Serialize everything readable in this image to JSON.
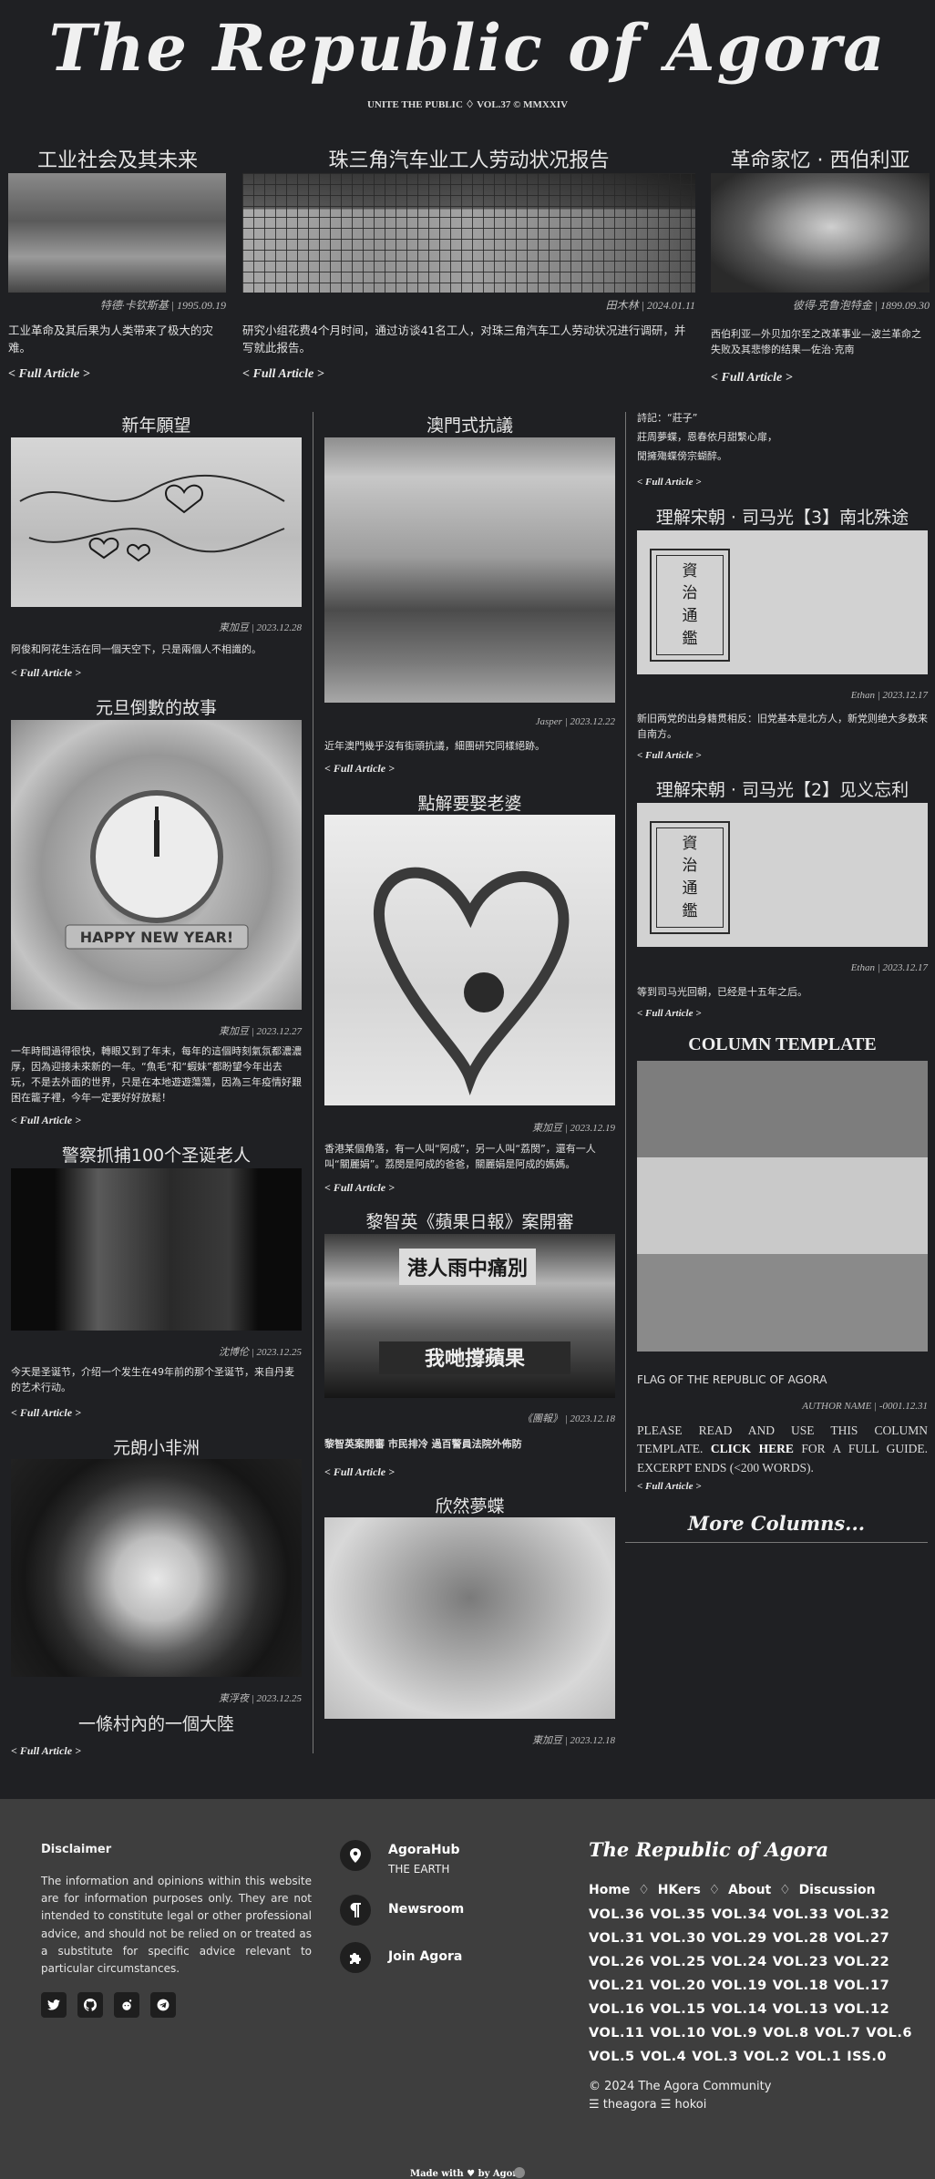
{
  "masthead": {
    "title": "The Republic of Agora",
    "subtitle": "UNITE THE PUBLIC ♢ VOL.37 © MMXXIV"
  },
  "top_row": [
    {
      "title": "工业社会及其未来",
      "credit": "特德·卡钦斯基 | 1995.09.19",
      "desc": "工业革命及其后果为人类带来了极大的灾难。",
      "more": "< Full Article >"
    },
    {
      "title": "珠三角汽车业工人劳动状况报告",
      "credit": "田木林 | 2024.01.11",
      "desc": "研究小组花费4个月时间，通过访谈41名工人，对珠三角汽车工人劳动状况进行调研，并写就此报告。",
      "more": "< Full Article >"
    },
    {
      "title": "革命家忆 · 西伯利亚",
      "credit": "彼得·克鲁泡特金 | 1899.09.30",
      "desc_line1": "西伯利亚—外贝加尔至之改革事业—波兰革命之",
      "desc_line2": "失败及其悲惨的结果—佐治·克南",
      "more": "< Full Article >"
    }
  ],
  "col1": [
    {
      "title": "新年願望",
      "credit": "東加豆 | 2023.12.28",
      "desc": "阿俊和阿花生活在同一個天空下，只是兩個人不相識的。",
      "more": "< Full Article >"
    },
    {
      "title": "元旦倒數的故事",
      "credit": "東加豆 | 2023.12.27",
      "desc": "一年時間過得很快，轉眼又到了年末，每年的這個時刻氣氛都濃濃厚，因為迎接未來新的一年。“魚毛”和“蝦妹”都盼望今年出去玩，不是去外面的世界，只是在本地遊遊蕩蕩，因為三年疫情好艱困在籠子裡，今年一定要好好放鬆！",
      "more": "< Full Article >",
      "clock_banner": "HAPPY NEW YEAR!"
    },
    {
      "title": "警察抓捕100个圣诞老人",
      "credit": "沈博伦 | 2023.12.25",
      "desc": "今天是圣诞节，介绍一个发生在49年前的那个圣诞节，来自丹麦的艺术行动。",
      "more": "< Full Article >"
    },
    {
      "title": "元朗小非洲",
      "credit": "東浮夜 | 2023.12.25",
      "subtitle": "一條村內的一個大陸",
      "more": "< Full Article >"
    }
  ],
  "col2": [
    {
      "title": "澳門式抗議",
      "credit": "Jasper | 2023.12.22",
      "desc": "近年澳門幾乎沒有街頭抗議，細團研究同樣絕跡。",
      "more": "< Full Article >"
    },
    {
      "title": "點解要娶老婆",
      "credit": "東加豆 | 2023.12.19",
      "desc": "香港某個角落，有一人叫“阿成”，另一人叫“荔閔”，還有一人叫“關麗娟”。荔閔是阿成的爸爸，關麗娟是阿成的媽媽。",
      "more": "< Full Article >"
    },
    {
      "title": "黎智英《蘋果日報》案開審",
      "credit": "《團報》 | 2023.12.18",
      "desc": "黎智英案開審 市民排冷 過百警員法院外佈防",
      "more": "< Full Article >",
      "poster_line1": "港人雨中痛別",
      "poster_line2": "我哋撐蘋果"
    },
    {
      "title": "欣然夢蝶",
      "credit": "東加豆 | 2023.12.18"
    }
  ],
  "col3": {
    "poem": {
      "line1": "詩記：“莊子”",
      "line2": "莊周夢蝶，恩春依月甜繫心扉，",
      "line3": "閒擁殤蝶傍宗蝴醉。",
      "more": "< Full Article >"
    },
    "articles": [
      {
        "title": "理解宋朝 · 司马光【3】南北殊途",
        "credit": "Ethan | 2023.12.17",
        "desc": "新旧两党的出身籍贯相反：旧党基本是北方人，新党则绝大多数来自南方。",
        "more": "< Full Article >",
        "book_chars": [
          "資",
          "治",
          "通",
          "鑑"
        ]
      },
      {
        "title": "理解宋朝 · 司马光【2】见义忘利",
        "credit": "Ethan | 2023.12.17",
        "desc": "等到司马光回朝，已经是十五年之后。",
        "more": "< Full Article >",
        "book_chars": [
          "資",
          "治",
          "通",
          "鑑"
        ]
      }
    ],
    "template": {
      "title": "COLUMN TEMPLATE",
      "caption": "FLAG OF THE REPUBLIC OF AGORA",
      "credit": "AUTHOR NAME | -0001.12.31",
      "body_pre": "PLEASE READ AND USE THIS COLUMN TEMPLATE.",
      "body_link": "CLICK HERE",
      "body_post": "FOR A FULL GUIDE. EXCERPT ENDS (<200 WORDS).",
      "more": "< Full Article >"
    },
    "more_columns": "More Columns..."
  },
  "footer": {
    "disclaimer_title": "Disclaimer",
    "disclaimer_text": "The information and opinions within this website are for information purposes only. They are not intended to constitute legal or other professional advice, and should not be relied on or treated as a substitute for specific advice relevant to particular circumstances.",
    "social": [
      "twitter-icon",
      "github-icon",
      "reddit-icon",
      "telegram-icon"
    ],
    "links": [
      {
        "label": "AgoraHub",
        "sub": "THE EARTH",
        "icon": "location-icon"
      },
      {
        "label": "Newsroom",
        "sub": "",
        "icon": "paragraph-icon"
      },
      {
        "label": "Join Agora",
        "sub": "",
        "icon": "puzzle-icon"
      }
    ],
    "brand": "The Republic of Agora",
    "nav": [
      "Home",
      "HKers",
      "About",
      "Discussion"
    ],
    "volumes": [
      [
        "VOL.36",
        "VOL.35",
        "VOL.34",
        "VOL.33",
        "VOL.32"
      ],
      [
        "VOL.31",
        "VOL.30",
        "VOL.29",
        "VOL.28",
        "VOL.27"
      ],
      [
        "VOL.26",
        "VOL.25",
        "VOL.24",
        "VOL.23",
        "VOL.22"
      ],
      [
        "VOL.21",
        "VOL.20",
        "VOL.19",
        "VOL.18",
        "VOL.17"
      ],
      [
        "VOL.16",
        "VOL.15",
        "VOL.14",
        "VOL.13",
        "VOL.12"
      ],
      [
        "VOL.11",
        "VOL.10",
        "VOL.9",
        "VOL.8",
        "VOL.7",
        "VOL.6"
      ],
      [
        "VOL.5",
        "VOL.4",
        "VOL.3",
        "VOL.2",
        "VOL.1",
        "ISS.0"
      ]
    ],
    "copyright": "© 2024 The Agora Community",
    "credits": "☰ theagora ☰ hokoi",
    "made_with": "Made with ♥ by Agora"
  }
}
